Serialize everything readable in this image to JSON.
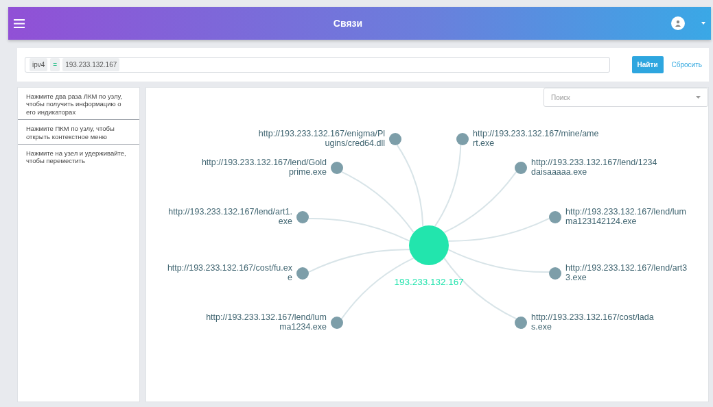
{
  "header": {
    "title": "Связи"
  },
  "filter": {
    "chips": [
      {
        "text": "ipv4",
        "kind": "field"
      },
      {
        "text": "=",
        "kind": "operator"
      },
      {
        "text": "193.233.132.167",
        "kind": "value"
      }
    ],
    "search_button": "Найти",
    "reset_link": "Сбросить"
  },
  "hints": [
    "Нажмите два раза ЛКМ по узлу, чтобы получить информацию о его индикаторах",
    "Нажмите ПКМ по узлу, чтобы открыть контекстное меню",
    "Нажмите на узел и удерживайте, чтобы переместить"
  ],
  "graph": {
    "search_placeholder": "Поиск",
    "center": {
      "label": "193.233.132.167"
    },
    "nodes": [
      {
        "label": "http://193.233.132.167/enigma/Plugins/cred64.dll"
      },
      {
        "label": "http://193.233.132.167/mine/amert.exe"
      },
      {
        "label": "http://193.233.132.167/lend/Goldprime.exe"
      },
      {
        "label": "http://193.233.132.167/lend/1234daisaaaaa.exe"
      },
      {
        "label": "http://193.233.132.167/lend/art1.exe"
      },
      {
        "label": "http://193.233.132.167/lend/lumma123142124.exe"
      },
      {
        "label": "http://193.233.132.167/cost/fu.exe"
      },
      {
        "label": "http://193.233.132.167/lend/art33.exe"
      },
      {
        "label": "http://193.233.132.167/lend/lumma1234.exe"
      },
      {
        "label": "http://193.233.132.167/cost/ladas.exe"
      }
    ]
  }
}
